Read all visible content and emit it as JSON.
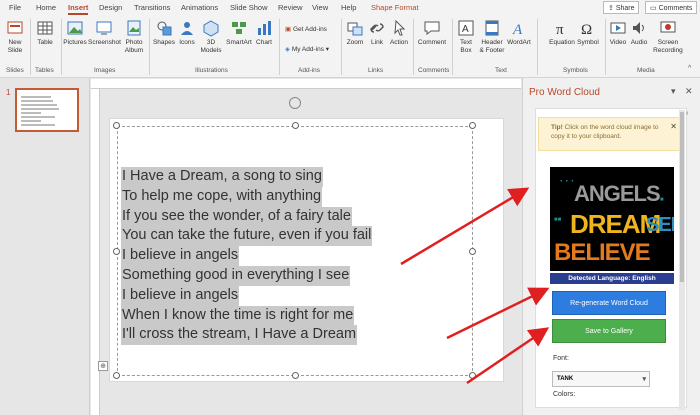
{
  "tabs": {
    "file": "File",
    "home": "Home",
    "insert": "Insert",
    "design": "Design",
    "transitions": "Transitions",
    "animations": "Animations",
    "slideshow": "Slide Show",
    "review": "Review",
    "view": "View",
    "help": "Help",
    "shape_format": "Shape Format"
  },
  "header_buttons": {
    "share": "Share",
    "comments": "Comments"
  },
  "ribbon": {
    "new_slide": "New\nSlide",
    "table": "Table",
    "pictures": "Pictures",
    "screenshot": "Screenshot",
    "photo_album": "Photo\nAlbum",
    "shapes": "Shapes",
    "icons": "Icons",
    "models_3d": "3D\nModels",
    "smartart": "SmartArt",
    "chart": "Chart",
    "get_addins": "Get Add-ins",
    "my_addins": "My Add-ins",
    "zoom": "Zoom",
    "link": "Link",
    "action": "Action",
    "comment": "Comment",
    "text_box": "Text\nBox",
    "header_footer": "Header\n& Footer",
    "wordart": "WordArt",
    "equation": "Equation",
    "symbol": "Symbol",
    "video": "Video",
    "audio": "Audio",
    "screen_recording": "Screen\nRecording",
    "groups": {
      "slides": "Slides",
      "tables": "Tables",
      "images": "Images",
      "illustrations": "Illustrations",
      "addins": "Add-ins",
      "links": "Links",
      "comments": "Comments",
      "text": "Text",
      "symbols": "Symbols",
      "media": "Media"
    }
  },
  "thumbnails": {
    "slide_number": "1"
  },
  "slide": {
    "lines": [
      "I Have a Dream, a song to sing",
      "To help me cope, with anything",
      "If you see the wonder, of a fairy tale",
      "You can take the future, even if you fail",
      "I believe in angels",
      "Something good in everything I see",
      "I believe in angels",
      "When I know the time is right for me",
      "I'll cross the stream, I Have a Dream"
    ]
  },
  "pane": {
    "title": "Pro Word Cloud",
    "tip_bold": "Tip!",
    "tip_text": " Click on the word cloud image to copy it to your clipboard.",
    "wordcloud_words": [
      "ANGELS",
      "DREAM",
      "SEE",
      "BELIEVE"
    ],
    "detected_language": "Detected Language: English",
    "regenerate_button": "Re-generate Word Cloud",
    "save_button": "Save to Gallery",
    "font_label": "Font:",
    "font_value": "TANK",
    "colors_label": "Colors:"
  },
  "colors": {
    "accent": "#b7472a",
    "regenerate": "#2d7de0",
    "save": "#4cae4c",
    "language_bar": "#2b3d8f",
    "arrows": "#e02020"
  },
  "icons": [
    "new-slide-icon",
    "table-icon",
    "pictures-icon",
    "screenshot-icon",
    "photo-album-icon",
    "shapes-icon",
    "icons-icon",
    "3d-models-icon",
    "smartart-icon",
    "chart-icon",
    "store-icon",
    "addins-icon",
    "zoom-icon",
    "link-icon",
    "action-icon",
    "comment-icon",
    "textbox-icon",
    "header-footer-icon",
    "wordart-icon",
    "equation-icon",
    "symbol-icon",
    "video-icon",
    "audio-icon",
    "screen-recording-icon",
    "rotate-handle-icon",
    "close-icon"
  ]
}
